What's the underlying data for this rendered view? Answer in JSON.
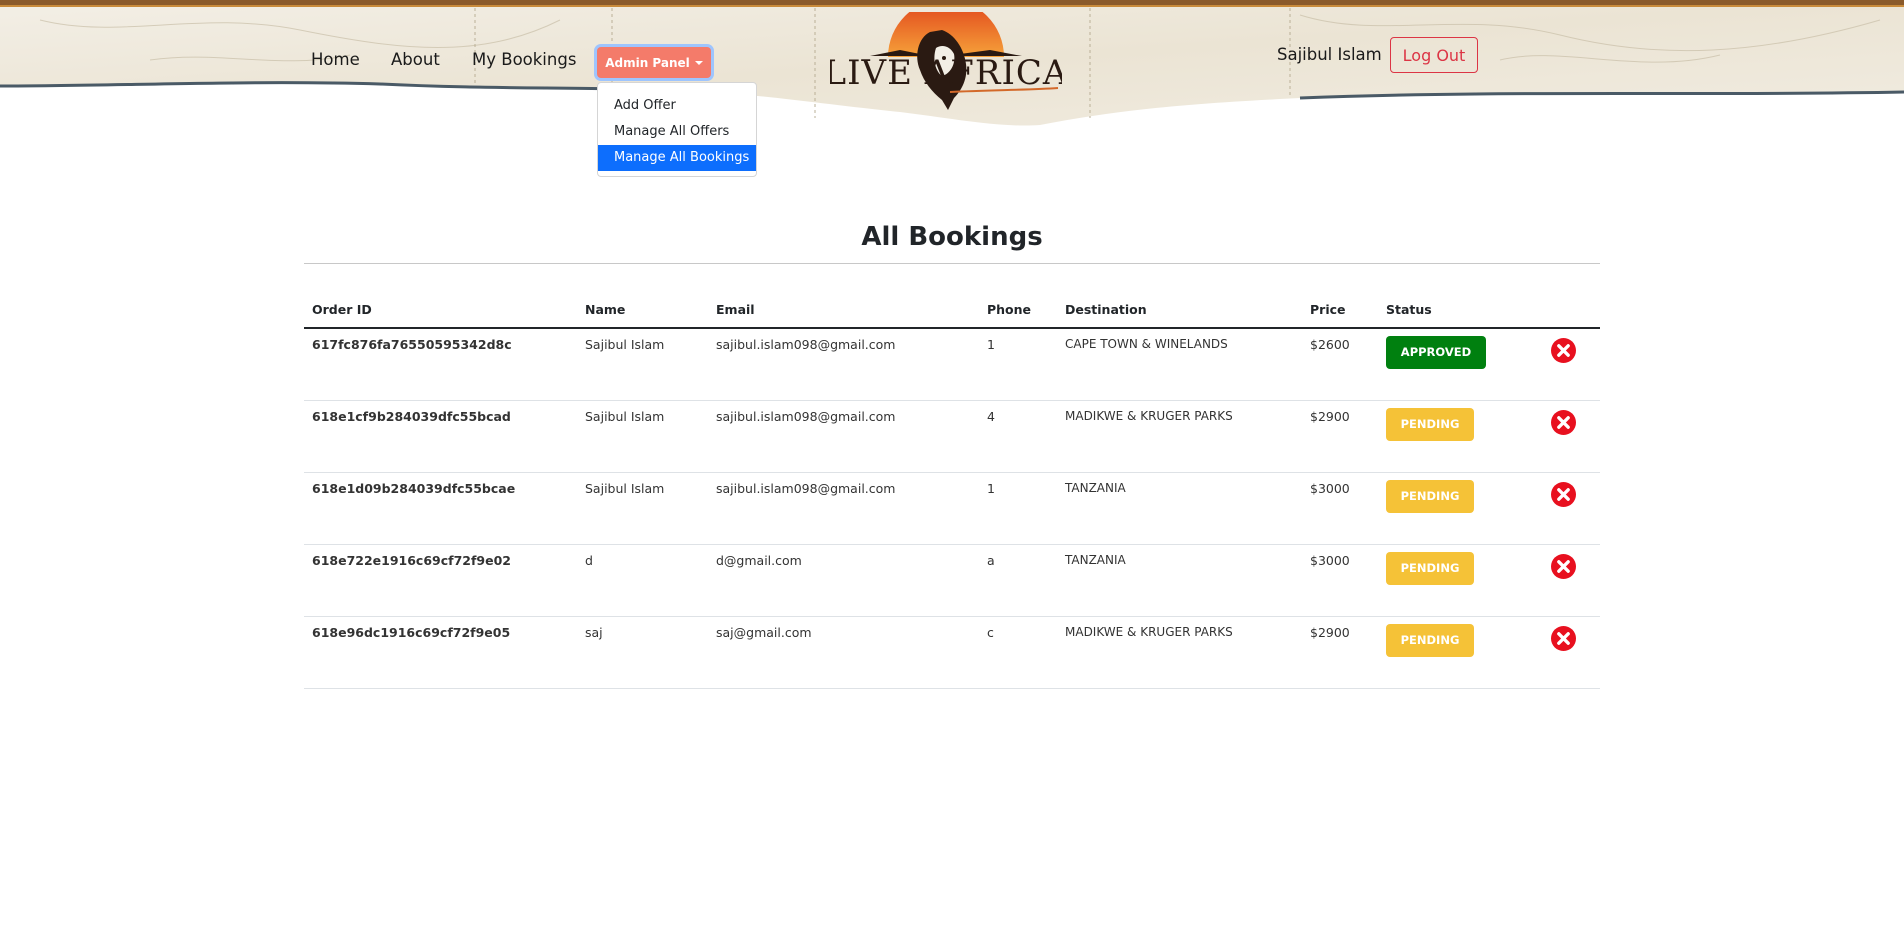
{
  "nav": {
    "links": [
      "Home",
      "About",
      "My Bookings"
    ],
    "admin_label": "Admin Panel",
    "brand": "LIVE AFRICA",
    "user_name": "Sajibul Islam",
    "logout_label": "Log Out"
  },
  "dropdown": {
    "items": [
      "Add Offer",
      "Manage All Offers",
      "Manage All Bookings"
    ],
    "active": "Manage All Bookings"
  },
  "page": {
    "title": "All Bookings"
  },
  "table": {
    "headers": [
      "Order ID",
      "Name",
      "Email",
      "Phone",
      "Destination",
      "Price",
      "Status"
    ],
    "rows": [
      {
        "order_id": "617fc876fa76550595342d8c",
        "name": "Sajibul Islam",
        "email": "sajibul.islam098@gmail.com",
        "phone": "1",
        "destination": "CAPE TOWN & WINELANDS",
        "price": "$2600",
        "status": "APPROVED"
      },
      {
        "order_id": "618e1cf9b284039dfc55bcad",
        "name": "Sajibul Islam",
        "email": "sajibul.islam098@gmail.com",
        "phone": "4",
        "destination": "MADIKWE & KRUGER PARKS",
        "price": "$2900",
        "status": "PENDING"
      },
      {
        "order_id": "618e1d09b284039dfc55bcae",
        "name": "Sajibul Islam",
        "email": "sajibul.islam098@gmail.com",
        "phone": "1",
        "destination": "TANZANIA",
        "price": "$3000",
        "status": "PENDING"
      },
      {
        "order_id": "618e722e1916c69cf72f9e02",
        "name": "d",
        "email": "d@gmail.com",
        "phone": "a",
        "destination": "TANZANIA",
        "price": "$3000",
        "status": "PENDING"
      },
      {
        "order_id": "618e96dc1916c69cf72f9e05",
        "name": "saj",
        "email": "saj@gmail.com",
        "phone": "c",
        "destination": "MADIKWE & KRUGER PARKS",
        "price": "$2900",
        "status": "PENDING"
      }
    ]
  },
  "colors": {
    "admin_button": "#f47b6a",
    "approved": "#00800f",
    "pending": "#f5c237",
    "delete": "#e8101f",
    "logout": "#dc3545",
    "dropdown_active": "#0d6efd"
  },
  "icons": {
    "delete": "close-circle-icon",
    "status_toggle": "caret-down-icon"
  }
}
